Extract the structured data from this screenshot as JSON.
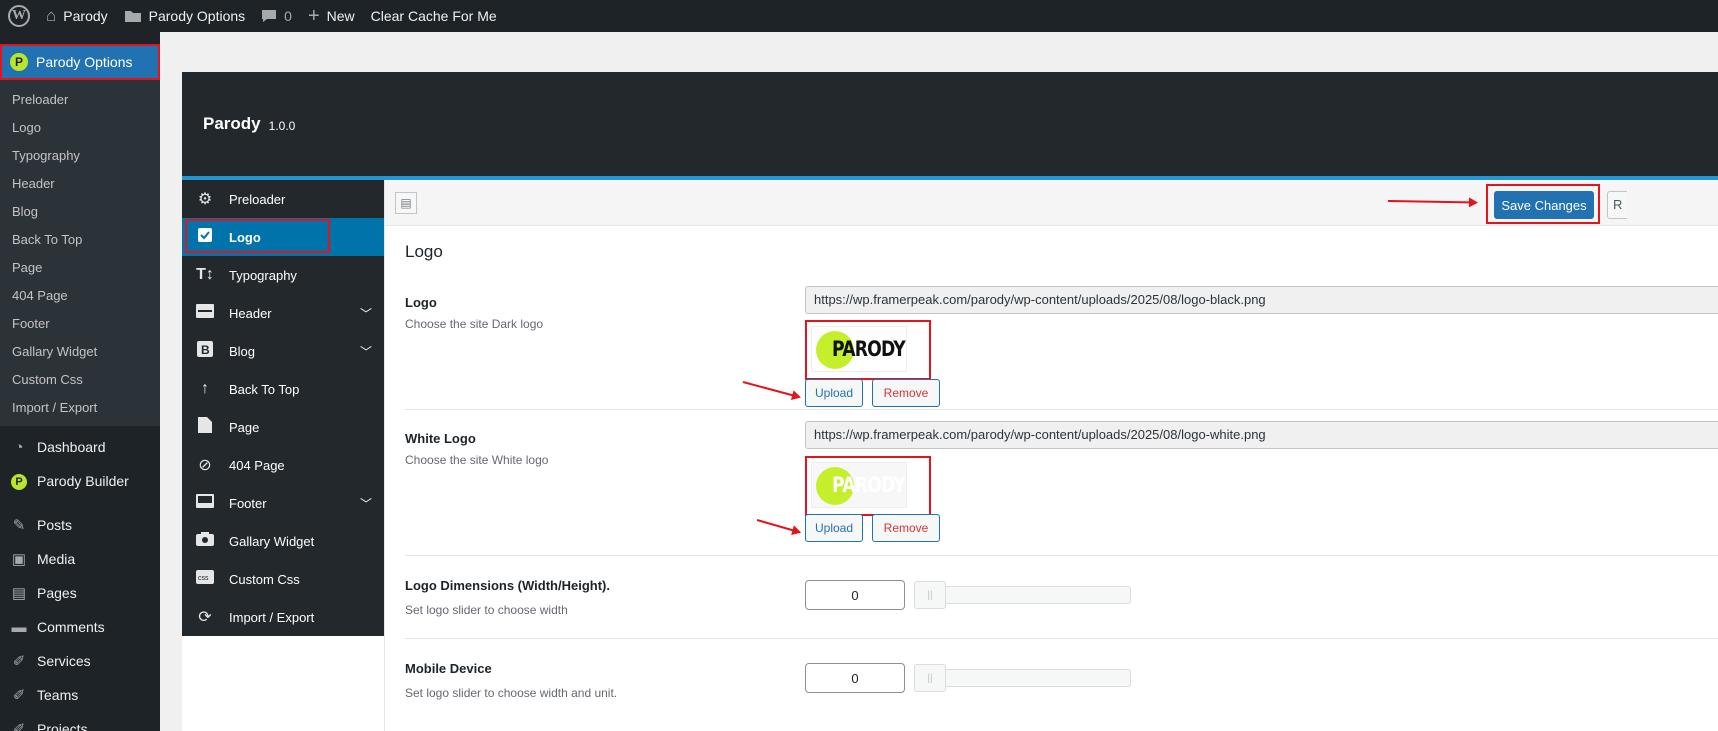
{
  "admin_bar": {
    "site_name": "Parody",
    "options_label": "Parody Options",
    "comments_count": "0",
    "new_label": "New",
    "clear_cache_label": "Clear Cache For Me"
  },
  "admin_menu": {
    "current": "Parody Options",
    "submenu": [
      "Preloader",
      "Logo",
      "Typography",
      "Header",
      "Blog",
      "Back To Top",
      "Page",
      "404 Page",
      "Footer",
      "Gallary Widget",
      "Custom Css",
      "Import / Export"
    ],
    "items": [
      {
        "label": "Dashboard",
        "icon": "dashboard-icon"
      },
      {
        "label": "Parody Builder",
        "icon": "parody-builder-icon"
      },
      {
        "label": "Posts",
        "icon": "pin-icon"
      },
      {
        "label": "Media",
        "icon": "media-icon"
      },
      {
        "label": "Pages",
        "icon": "pages-icon"
      },
      {
        "label": "Comments",
        "icon": "comment-icon"
      },
      {
        "label": "Services",
        "icon": "services-icon"
      },
      {
        "label": "Teams",
        "icon": "teams-icon"
      },
      {
        "label": "Projects",
        "icon": "projects-icon"
      }
    ]
  },
  "panel": {
    "title": "Parody",
    "version": "1.0.0"
  },
  "options_nav": {
    "items": [
      {
        "label": "Preloader",
        "icon": "gear-icon",
        "active": false,
        "has_children": false
      },
      {
        "label": "Logo",
        "icon": "logo-icon",
        "active": true,
        "has_children": false
      },
      {
        "label": "Typography",
        "icon": "text-height-icon",
        "active": false,
        "has_children": false
      },
      {
        "label": "Header",
        "icon": "header-icon",
        "active": false,
        "has_children": true
      },
      {
        "label": "Blog",
        "icon": "blog-icon",
        "active": false,
        "has_children": true
      },
      {
        "label": "Back To Top",
        "icon": "arrow-up-icon",
        "active": false,
        "has_children": false
      },
      {
        "label": "Page",
        "icon": "page-icon",
        "active": false,
        "has_children": false
      },
      {
        "label": "404 Page",
        "icon": "ban-icon",
        "active": false,
        "has_children": false
      },
      {
        "label": "Footer",
        "icon": "footer-icon",
        "active": false,
        "has_children": true
      },
      {
        "label": "Gallary Widget",
        "icon": "camera-icon",
        "active": false,
        "has_children": false
      },
      {
        "label": "Custom Css",
        "icon": "css-icon",
        "active": false,
        "has_children": false
      },
      {
        "label": "Import / Export",
        "icon": "refresh-icon",
        "active": false,
        "has_children": false
      }
    ]
  },
  "toolbar": {
    "save_label": "Save Changes",
    "reset_label": "R"
  },
  "section": {
    "title": "Logo",
    "fields": [
      {
        "title": "Logo",
        "description": "Choose the site Dark logo",
        "url": "https://wp.framerpeak.com/parody/wp-content/uploads/2025/08/logo-black.png",
        "preview_text": "PARODY",
        "upload_label": "Upload",
        "remove_label": "Remove"
      },
      {
        "title": "White Logo",
        "description": "Choose the site White logo",
        "url": "https://wp.framerpeak.com/parody/wp-content/uploads/2025/08/logo-white.png",
        "preview_text": "PARODY",
        "upload_label": "Upload",
        "remove_label": "Remove"
      },
      {
        "title": "Logo Dimensions (Width/Height).",
        "description": "Set logo slider to choose width",
        "value": "0",
        "slider_level": 0
      },
      {
        "title": "Mobile Device",
        "description": "Set logo slider to choose width and unit.",
        "value": "0",
        "slider_level": 0
      }
    ]
  },
  "colors": {
    "accent": "#2271b1",
    "nav_active": "#0073aa",
    "highlight": "#e3141c",
    "brand_lime": "#c4ef2a"
  }
}
